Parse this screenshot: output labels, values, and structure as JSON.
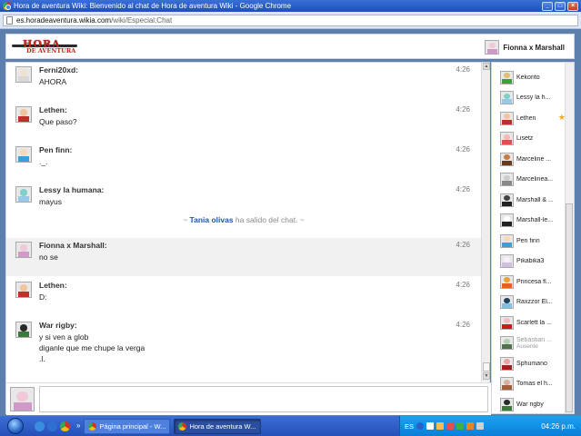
{
  "window": {
    "title": "Hora de aventura Wiki: Bienvenido al chat de Hora de aventura Wiki - Google Chrome",
    "url_host": "es.horadeaventura.wikia.com",
    "url_path": "/wiki/Especial:Chat"
  },
  "header": {
    "logo_line1": "HORA",
    "logo_line2": "DE AVENTURA",
    "current_user": "Fionna x Marshall"
  },
  "messages": [
    {
      "name": "Ferni20xd:",
      "lines": [
        "AHORA"
      ],
      "time": "4:26",
      "colors": [
        "#f0e0d0",
        "#d8d8d8"
      ]
    },
    {
      "name": "Lethen:",
      "lines": [
        "Que paso?"
      ],
      "time": "4:26",
      "colors": [
        "#f2c49c",
        "#c0302a"
      ]
    },
    {
      "name": "Pen finn:",
      "lines": [
        "._."
      ],
      "time": "4:26",
      "colors": [
        "#f7d8b8",
        "#3aa0d8"
      ]
    },
    {
      "name": "Lessy la humana:",
      "lines": [
        "mayus"
      ],
      "time": "4:26",
      "colors": [
        "#7fd0c8",
        "#9ac8e8"
      ]
    },
    {
      "name": "Fionna x Marshall:",
      "lines": [
        "no se"
      ],
      "time": "4:26",
      "colors": [
        "#f0c8d8",
        "#d09ac8"
      ]
    },
    {
      "name": "Lethen:",
      "lines": [
        "D:"
      ],
      "time": "4:26",
      "colors": [
        "#f2c49c",
        "#c0302a"
      ]
    },
    {
      "name": "War rigby:",
      "lines": [
        "y si ven a glob",
        "diganle que me chupe la verga",
        ".l."
      ],
      "time": "4:26",
      "colors": [
        "#2a2a2a",
        "#3a7a3a"
      ]
    }
  ],
  "inline_alert": {
    "prefix": "~ ",
    "user": "Tania olivas",
    "text": " ha salido del chat. ~"
  },
  "users": [
    {
      "name": "Kekorito",
      "colors": [
        "#e0c070",
        "#40a040"
      ]
    },
    {
      "name": "Lessy la h...",
      "colors": [
        "#7fd0c8",
        "#9ac8e8"
      ]
    },
    {
      "name": "Lethen",
      "colors": [
        "#f2c49c",
        "#c0302a"
      ],
      "star": "★"
    },
    {
      "name": "Lisetz",
      "colors": [
        "#f4b8b8",
        "#e05050"
      ]
    },
    {
      "name": "Marceline ...",
      "colors": [
        "#c87a40",
        "#6a3a20"
      ]
    },
    {
      "name": "Marcelinea...",
      "colors": [
        "#cccccc",
        "#888888"
      ]
    },
    {
      "name": "Marshall & ...",
      "colors": [
        "#444444",
        "#222222"
      ]
    },
    {
      "name": "Marshall-le...",
      "colors": [
        "#ffffff",
        "#222222"
      ]
    },
    {
      "name": "Pen finn",
      "colors": [
        "#f7d8b8",
        "#3aa0d8"
      ]
    },
    {
      "name": "Pikabika3",
      "colors": [
        "#f8f0f8",
        "#cfc0e0"
      ]
    },
    {
      "name": "Princesa fl...",
      "colors": [
        "#f0a030",
        "#e86020"
      ]
    },
    {
      "name": "Raxzzor El...",
      "colors": [
        "#204060",
        "#80c0e0"
      ]
    },
    {
      "name": "Scarlett la ...",
      "colors": [
        "#f0c0c0",
        "#c02020"
      ]
    },
    {
      "name": "Sebastian ...",
      "sub": "Ausente",
      "away": true,
      "colors": [
        "#b0d0b0",
        "#507050"
      ]
    },
    {
      "name": "Sphumano",
      "colors": [
        "#f0a0a0",
        "#a02020"
      ]
    },
    {
      "name": "Tomas el h...",
      "colors": [
        "#d8b0a0",
        "#a06040"
      ]
    },
    {
      "name": "War rigby",
      "colors": [
        "#2a2a2a",
        "#3a7a3a"
      ]
    }
  ],
  "taskbar": {
    "more": "»",
    "task1": "Página principal - W...",
    "task2": "Hora de aventura W...",
    "lang": "ES",
    "clock": "04:26 p.m."
  }
}
